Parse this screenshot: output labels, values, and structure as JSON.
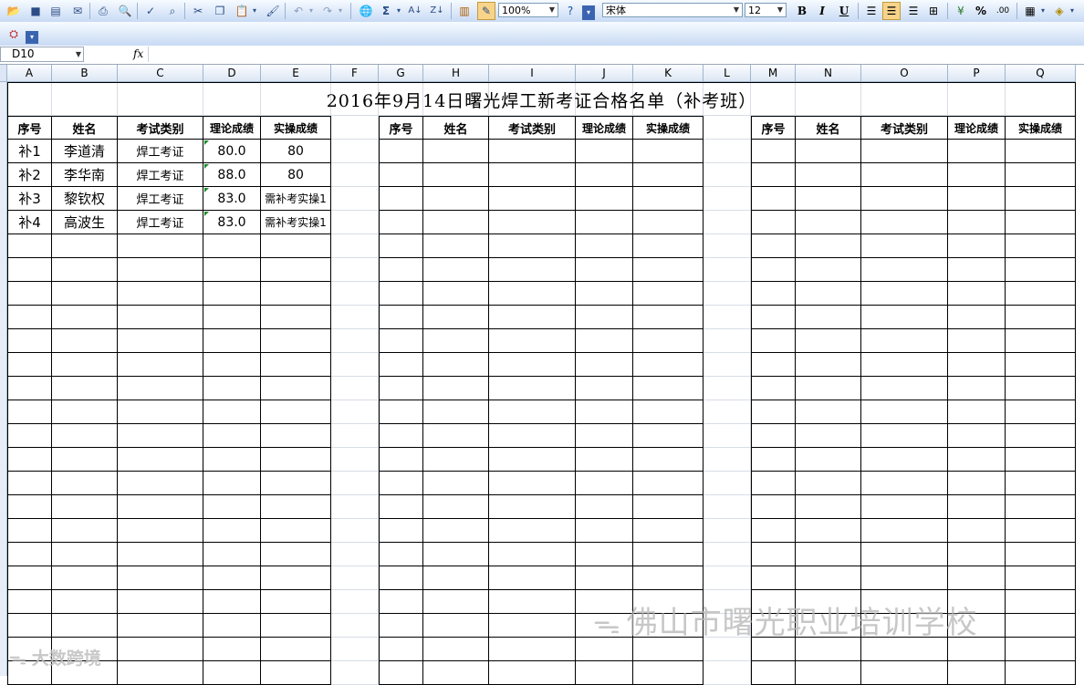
{
  "toolbar": {
    "zoom": "100%",
    "font": "宋体",
    "font_size": "12",
    "sum_symbol": "Σ",
    "bold": "B",
    "italic": "I",
    "underline": "U",
    "percent": "%"
  },
  "formula_bar": {
    "name_box": "D10",
    "fx": "fx"
  },
  "columns": [
    "A",
    "B",
    "C",
    "D",
    "E",
    "F",
    "G",
    "H",
    "I",
    "J",
    "K",
    "L",
    "M",
    "N",
    "O",
    "P",
    "Q"
  ],
  "sheet": {
    "title": "2016年9月14日曙光焊工新考证合格名单（补考班）",
    "headers": [
      "序号",
      "姓名",
      "考试类别",
      "理论成绩",
      "实操成绩"
    ],
    "rows": [
      [
        "补1",
        "李道清",
        "焊工考证",
        "80.0",
        "80"
      ],
      [
        "补2",
        "李华南",
        "焊工考证",
        "88.0",
        "80"
      ],
      [
        "补3",
        "黎钦权",
        "焊工考证",
        "83.0",
        "需补考实操1"
      ],
      [
        "补4",
        "高波生",
        "焊工考证",
        "83.0",
        "需补考实操1"
      ]
    ]
  },
  "watermarks": {
    "school": "佛山市曙光职业培训学校",
    "source": "大数跨境"
  }
}
